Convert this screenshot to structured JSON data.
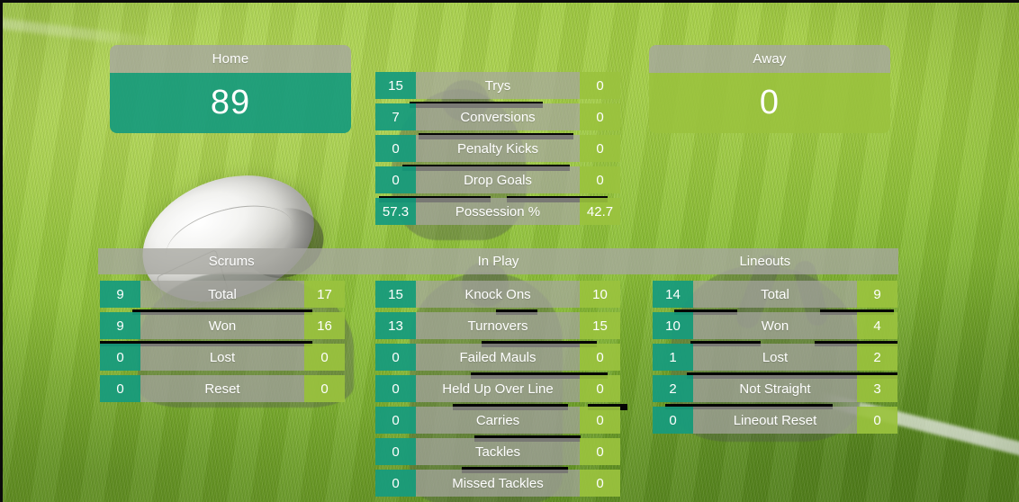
{
  "scoreboard": {
    "home": {
      "title": "Home",
      "score": "89"
    },
    "away": {
      "title": "Away",
      "score": "0"
    }
  },
  "scoring_table": {
    "rows": [
      {
        "home": "15",
        "label": "Trys",
        "away": "0"
      },
      {
        "home": "7",
        "label": "Conversions",
        "away": "0"
      },
      {
        "home": "0",
        "label": "Penalty Kicks",
        "away": "0"
      },
      {
        "home": "0",
        "label": "Drop Goals",
        "away": "0"
      },
      {
        "home": "57.3",
        "label": "Possession %",
        "away": "42.7"
      }
    ]
  },
  "sections": [
    {
      "title": "Scrums",
      "rows": [
        {
          "home": "9",
          "label": "Total",
          "away": "17"
        },
        {
          "home": "9",
          "label": "Won",
          "away": "16"
        },
        {
          "home": "0",
          "label": "Lost",
          "away": "0"
        },
        {
          "home": "0",
          "label": "Reset",
          "away": "0"
        }
      ]
    },
    {
      "title": "In Play",
      "rows": [
        {
          "home": "15",
          "label": "Knock Ons",
          "away": "10"
        },
        {
          "home": "13",
          "label": "Turnovers",
          "away": "15"
        },
        {
          "home": "0",
          "label": "Failed Mauls",
          "away": "0"
        },
        {
          "home": "0",
          "label": "Held Up Over Line",
          "away": "0"
        },
        {
          "home": "0",
          "label": "Carries",
          "away": "0"
        },
        {
          "home": "0",
          "label": "Tackles",
          "away": "0"
        },
        {
          "home": "0",
          "label": "Missed Tackles",
          "away": "0"
        }
      ]
    },
    {
      "title": "Lineouts",
      "rows": [
        {
          "home": "14",
          "label": "Total",
          "away": "9"
        },
        {
          "home": "10",
          "label": "Won",
          "away": "4"
        },
        {
          "home": "1",
          "label": "Lost",
          "away": "2"
        },
        {
          "home": "2",
          "label": "Not Straight",
          "away": "3"
        },
        {
          "home": "0",
          "label": "Lineout Reset",
          "away": "0"
        }
      ]
    }
  ],
  "theme": {
    "home_color": "#179b7c",
    "away_color": "#9ac23e",
    "label_color": "#a6a6a0",
    "text_color": "#ffffff",
    "pitch_color": "#8dc136"
  }
}
